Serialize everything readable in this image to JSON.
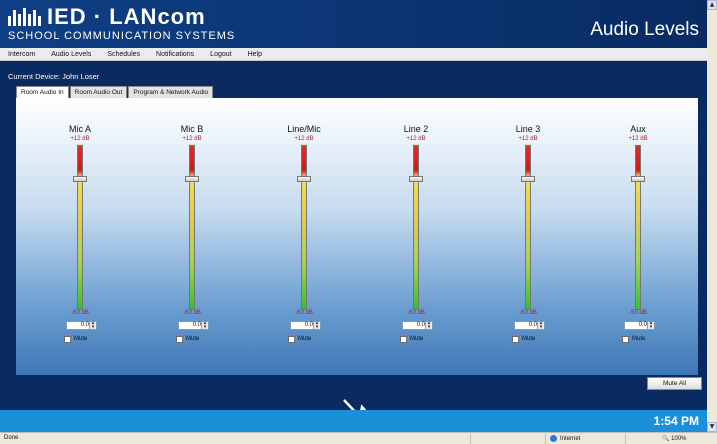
{
  "header": {
    "logo_text": "IED · LANcom",
    "logo_subtitle": "SCHOOL COMMUNICATION SYSTEMS",
    "page_title": "Audio Levels"
  },
  "menu": [
    "Intercom",
    "Audio Levels",
    "Schedules",
    "Notifications",
    "Logout",
    "Help"
  ],
  "device_label": "Current Device: John Loser",
  "tabs": [
    "Room Audio In",
    "Room Audio Out",
    "Program & Network Audio"
  ],
  "active_tab": "Room Audio In",
  "channels": [
    {
      "name": "Mic A",
      "max": "+12 dB",
      "min": "-50 dB",
      "value": "0.0",
      "mute_label": "Mute",
      "muted": false,
      "level": 0.806
    },
    {
      "name": "Mic B",
      "max": "+12 dB",
      "min": "-50 dB",
      "value": "0.0",
      "mute_label": "Mute",
      "muted": false,
      "level": 0.806
    },
    {
      "name": "Line/Mic",
      "max": "+12 dB",
      "min": "-50 dB",
      "value": "0.0",
      "mute_label": "Mute",
      "muted": false,
      "level": 0.806
    },
    {
      "name": "Line 2",
      "max": "+12 dB",
      "min": "-50 dB",
      "value": "0.0",
      "mute_label": "Mute",
      "muted": false,
      "level": 0.806
    },
    {
      "name": "Line 3",
      "max": "+12 dB",
      "min": "-50 dB",
      "value": "0.0",
      "mute_label": "Mute",
      "muted": false,
      "level": 0.806
    },
    {
      "name": "Aux",
      "max": "+12 dB",
      "min": "-50 dB",
      "value": "0.0",
      "mute_label": "Mute",
      "muted": false,
      "level": 0.806
    }
  ],
  "mute_all_label": "Mute All",
  "clock": "1:54 PM",
  "statusbar": {
    "left": "Done",
    "zone": "Internet",
    "zoom": "100%"
  },
  "colors": {
    "header_blue": "#0b3472",
    "footer_blue": "#1b8fd8",
    "db_label_red": "#b21b1b"
  }
}
